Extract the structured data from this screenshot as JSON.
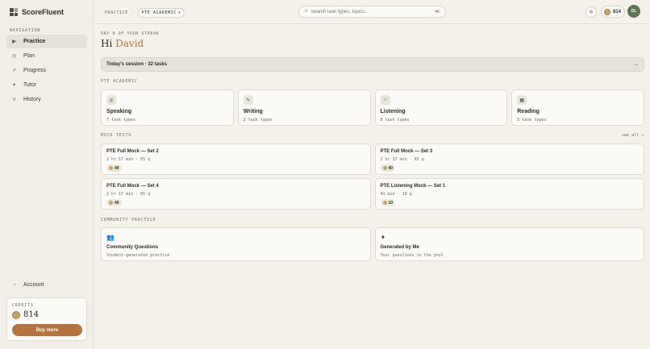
{
  "app": {
    "name": "ScoreFluent"
  },
  "sidebar": {
    "heading": "NAVIGATION",
    "items": [
      {
        "label": "Practice",
        "icon": "play-icon",
        "active": true
      },
      {
        "label": "Plan",
        "icon": "calendar-icon"
      },
      {
        "label": "Progress",
        "icon": "trend-icon"
      },
      {
        "label": "Tutor",
        "icon": "sparkle-icon"
      },
      {
        "label": "History",
        "icon": "list-icon"
      }
    ],
    "account_label": "Account",
    "credits": {
      "label": "CREDITS",
      "value": "814",
      "buy_label": "Buy more"
    }
  },
  "topbar": {
    "crumb_root": "PRACTICE",
    "crumb_separator": "·",
    "crumb_current": "PTE ACADEMIC",
    "search_placeholder": "Search task types, topics...",
    "search_shortcut": "⌘K",
    "credits": "814",
    "avatar_initials": "DL"
  },
  "main": {
    "streak": "DAY 0 OF YOUR STREAK",
    "greeting_prefix": "Hi",
    "greeting_name": "David",
    "session_label": "Today's session · 32 tasks",
    "session_arrow": "→",
    "section_pte": "PTE ACADEMIC",
    "skills": [
      {
        "title": "Speaking",
        "sub": "7 task types",
        "icon": "mic-icon"
      },
      {
        "title": "Writing",
        "sub": "2 task types",
        "icon": "pen-icon"
      },
      {
        "title": "Listening",
        "sub": "8 task types",
        "icon": "music-note-icon"
      },
      {
        "title": "Reading",
        "sub": "5 task types",
        "icon": "book-icon"
      }
    ],
    "section_mocks": "MOCK TESTS",
    "see_all": "see all →",
    "mocks": [
      {
        "title": "PTE Full Mock — Set 2",
        "meta": "2 hr 17 min · 65 q",
        "badge": "40"
      },
      {
        "title": "PTE Full Mock — Set 3",
        "meta": "2 hr 17 min · 65 q",
        "badge": "40"
      },
      {
        "title": "PTE Full Mock — Set 4",
        "meta": "2 hr 17 min · 65 q",
        "badge": "40"
      },
      {
        "title": "PTE Listening Mock — Set 1",
        "meta": "41 min · 19 q",
        "badge": "10"
      }
    ],
    "section_community": "COMMUNITY PRACTICE",
    "community": [
      {
        "title": "Community Questions",
        "sub": "Student-generated practice",
        "icon": "people-icon"
      },
      {
        "title": "Generated by Me",
        "sub": "Your questions in the pool",
        "icon": "sparkle-icon"
      }
    ]
  },
  "colors": {
    "accent": "#b5743f",
    "avatar": "#5f7450",
    "background": "#f3f1ea"
  }
}
